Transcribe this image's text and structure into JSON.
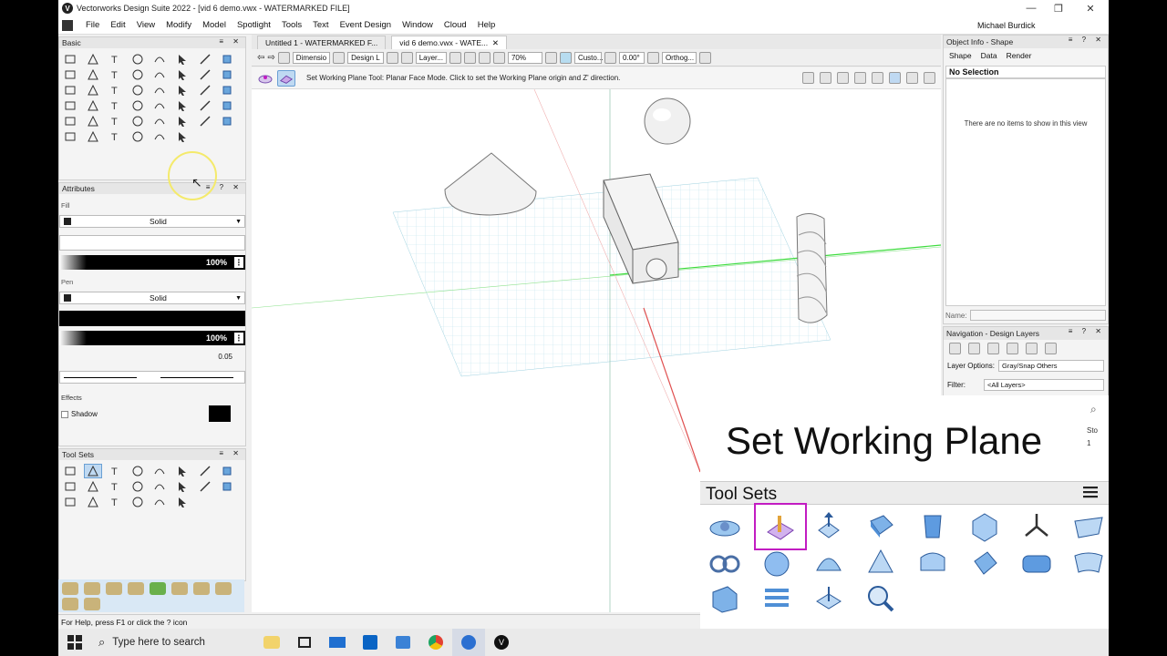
{
  "window": {
    "title": "Vectorworks Design Suite 2022 - [vid 6 demo.vwx - WATERMARKED FILE]",
    "min": "—",
    "restore": "❐",
    "close": "✕"
  },
  "menubar": {
    "items": [
      "File",
      "Edit",
      "View",
      "Modify",
      "Model",
      "Spotlight",
      "Tools",
      "Text",
      "Event Design",
      "Window",
      "Cloud",
      "Help"
    ],
    "user": "Michael Burdick"
  },
  "basic_palette": {
    "title": "Basic"
  },
  "attributes": {
    "title": "Attributes",
    "fill_label": "Fill",
    "fill_style": "Solid",
    "fill_opacity": "100%",
    "pen_label": "Pen",
    "pen_style": "Solid",
    "pen_opacity": "100%",
    "line_weight": "0.05",
    "effects_label": "Effects",
    "shadow_label": "Shadow"
  },
  "toolsets_palette": {
    "title": "Tool Sets"
  },
  "doc_tabs": [
    {
      "label": "Untitled 1 - WATERMARKED F..."
    },
    {
      "label": "vid 6 demo.vwx - WATE..."
    }
  ],
  "viewbar": {
    "class_dd": "Dimensio",
    "layer_dd": "Design L",
    "layer2_dd": "Layer...",
    "zoom": "70%",
    "custom": "Custo...",
    "angle": "0.00°",
    "projection": "Orthog..."
  },
  "mode_bar": {
    "hint": "Set Working Plane Tool: Planar Face Mode. Click to set the Working Plane origin and Z' direction."
  },
  "object_info": {
    "title": "Object Info - Shape",
    "tabs": [
      "Shape",
      "Data",
      "Render"
    ],
    "selection": "No Selection",
    "empty": "There are no items to show in this view",
    "name_label": "Name:"
  },
  "navigation": {
    "title": "Navigation - Design Layers",
    "layer_options_label": "Layer Options:",
    "layer_options_value": "Gray/Snap Others",
    "filter_label": "Filter:",
    "filter_value": "<All Layers>",
    "col_sto": "Sto",
    "row_val": "1"
  },
  "status": {
    "help": "For Help, press F1 or click the ? icon"
  },
  "callout": {
    "title": "Set Working Plane",
    "toolsets_label": "Tool Sets"
  },
  "taskbar": {
    "search": "Type here to search"
  },
  "colors": {
    "highlight": "#c21cc2",
    "accent_blue": "#2b6fd1",
    "grid": "#bfe3ec",
    "axis_green": "#3ddc3d",
    "axis_red": "#e05050"
  }
}
